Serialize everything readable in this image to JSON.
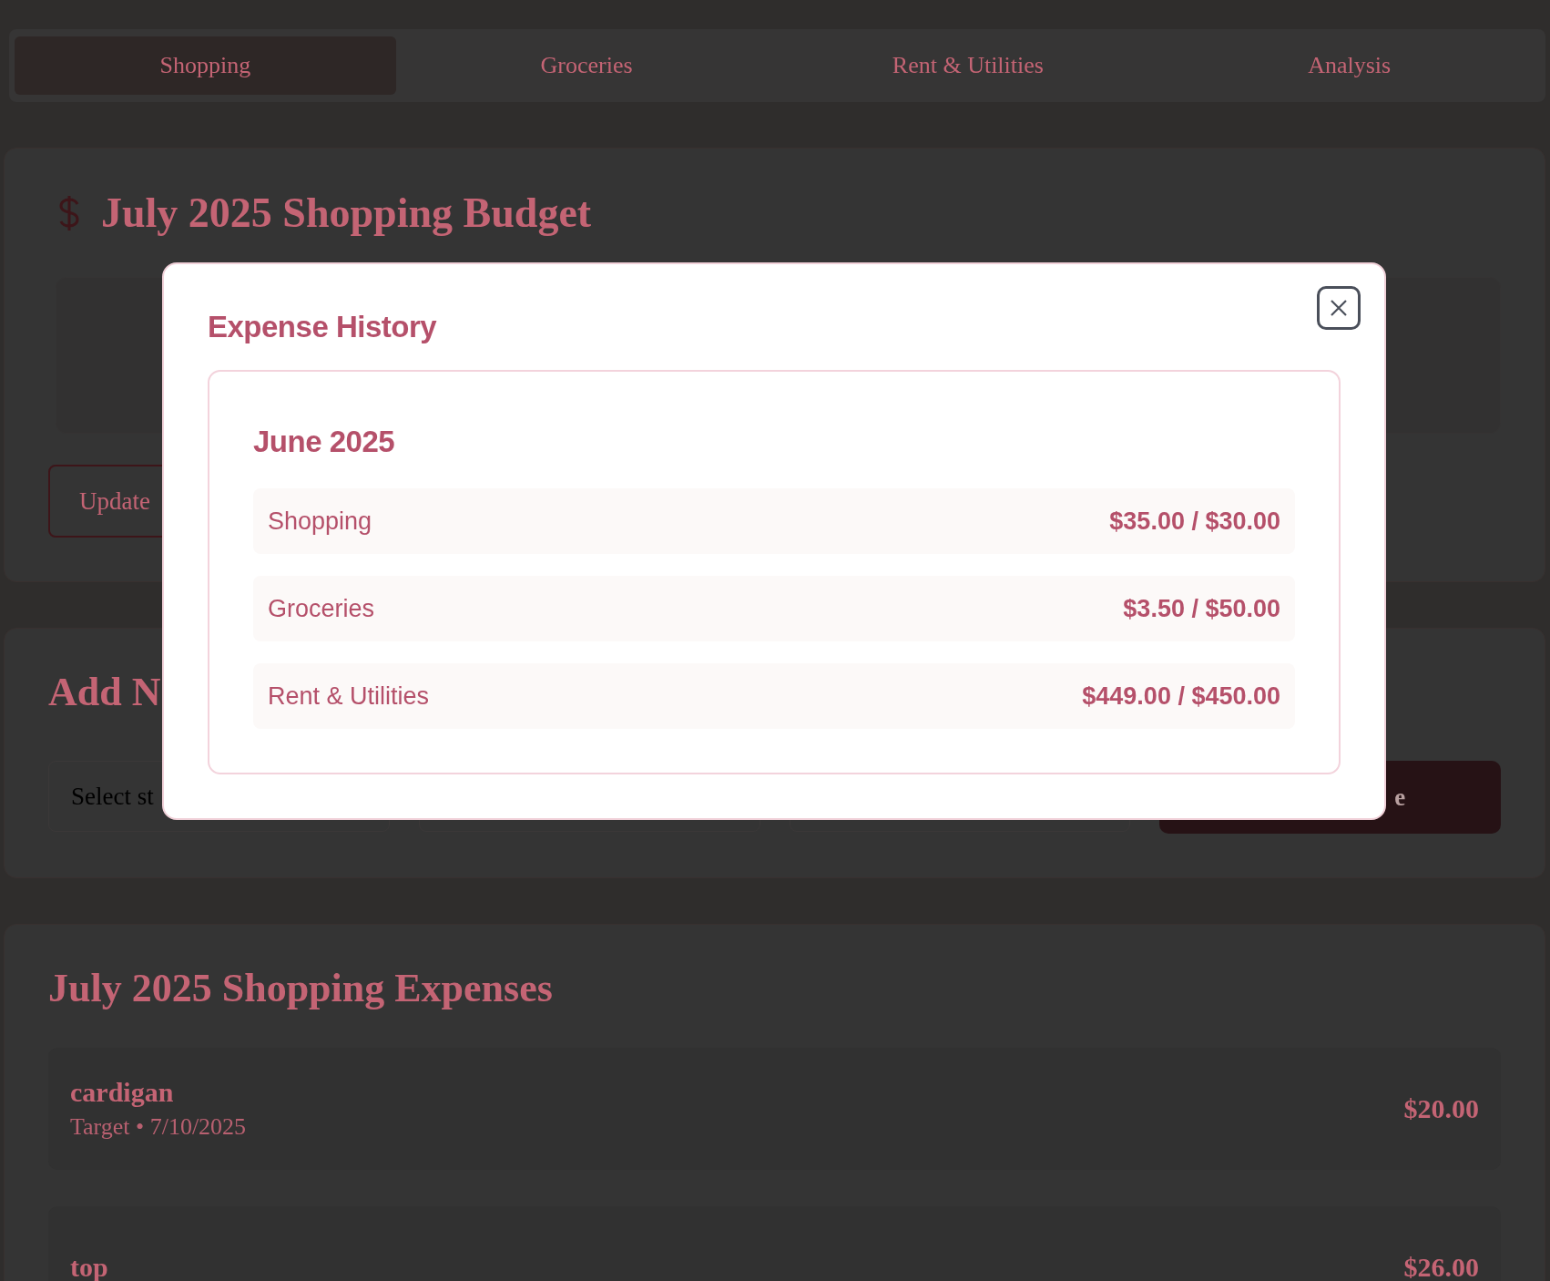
{
  "tabs": [
    {
      "label": "Shopping",
      "selected": true
    },
    {
      "label": "Groceries",
      "selected": false
    },
    {
      "label": "Rent & Utilities",
      "selected": false
    },
    {
      "label": "Analysis",
      "selected": false
    }
  ],
  "budget": {
    "title": "July 2025 Shopping Budget",
    "update_button": "Update"
  },
  "add_expense": {
    "title": "Add N",
    "store_select": {
      "value": "Select st"
    },
    "submit_button": "e"
  },
  "expenses": {
    "title": "July 2025 Shopping Expenses",
    "items": [
      {
        "name": "cardigan",
        "meta": "Target • 7/10/2025",
        "amount": "$20.00"
      },
      {
        "name": "top",
        "amount": "$26.00"
      }
    ]
  },
  "modal": {
    "title": "Expense History",
    "months": [
      {
        "title": "June 2025",
        "rows": [
          {
            "category": "Shopping",
            "amount": "$35.00 / $30.00"
          },
          {
            "category": "Groceries",
            "amount": "$3.50 / $50.00"
          },
          {
            "category": "Rent & Utilities",
            "amount": "$449.00 / $450.00"
          }
        ]
      }
    ]
  }
}
